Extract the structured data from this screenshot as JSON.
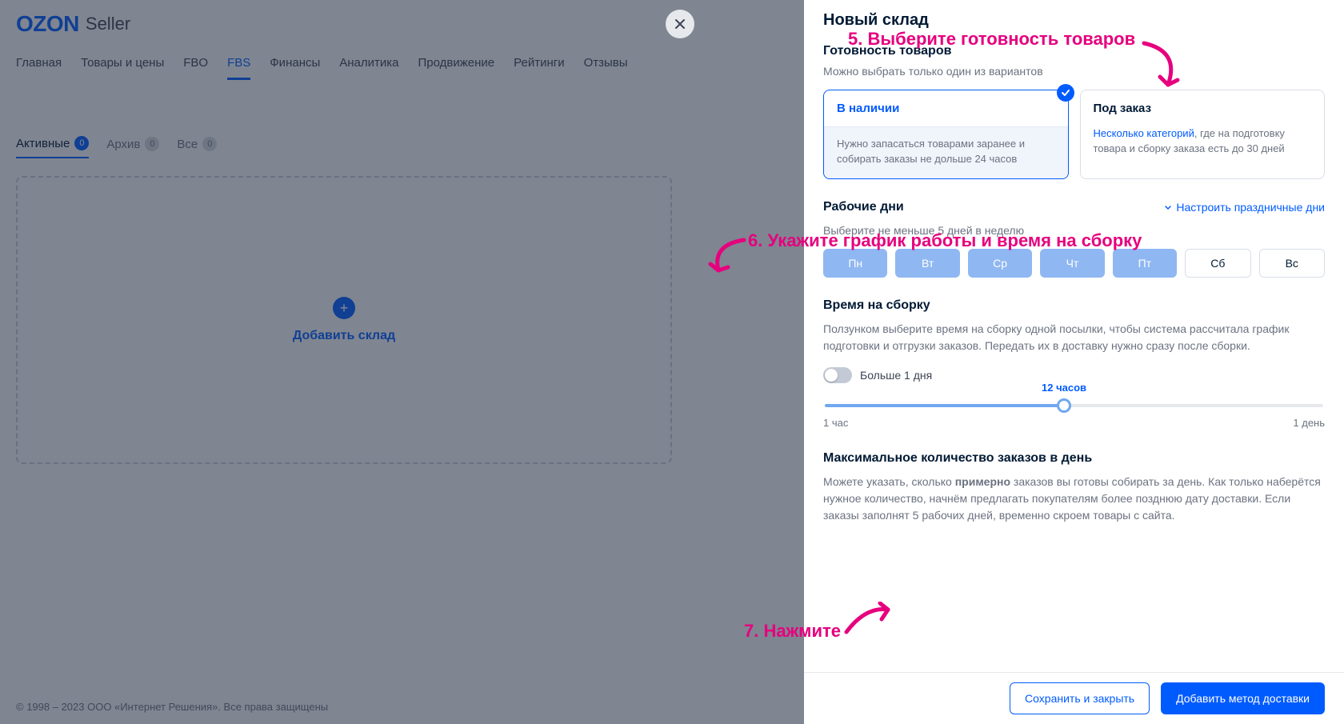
{
  "header": {
    "logo": "OZON",
    "logo_sub": "Seller"
  },
  "nav": {
    "items": [
      "Главная",
      "Товары и цены",
      "FBO",
      "FBS",
      "Финансы",
      "Аналитика",
      "Продвижение",
      "Рейтинги",
      "Отзывы"
    ],
    "active_index": 3
  },
  "subnav": {
    "items": [
      {
        "label": "Активные",
        "count": "0",
        "active": true
      },
      {
        "label": "Архив",
        "count": "0",
        "active": false
      },
      {
        "label": "Все",
        "count": "0",
        "active": false
      }
    ]
  },
  "panel": {
    "add_label": "Добавить склад"
  },
  "footer": "© 1998 – 2023 ООО «Интернет Решения». Все права защищены",
  "sheet": {
    "title": "Новый склад",
    "readiness": {
      "heading": "Готовность товаров",
      "sub": "Можно выбрать только один из вариантов",
      "card_a": {
        "title": "В наличии",
        "body": "Нужно запасаться товарами заранее и собирать заказы не дольше 24 часов"
      },
      "card_b": {
        "title": "Под заказ",
        "link": "Несколько категорий",
        "body_rest": ", где на подготовку товара и сборку заказа есть до 30 дней"
      }
    },
    "days": {
      "heading": "Рабочие дни",
      "config": "Настроить праздничные дни",
      "sub": "Выберите не меньше 5 дней в неделю",
      "labels": [
        "Пн",
        "Вт",
        "Ср",
        "Чт",
        "Пт",
        "Сб",
        "Вс"
      ],
      "selected": [
        true,
        true,
        true,
        true,
        true,
        false,
        false
      ]
    },
    "assembly": {
      "heading": "Время на сборку",
      "sub": "Ползунком выберите время на сборку одной посылки, чтобы система рассчитала график подготовки и отгрузки заказов. Передать их в доставку нужно сразу после сборки.",
      "toggle_label": "Больше 1 дня",
      "toggle_on": false,
      "slider": {
        "min_label": "1 час",
        "max_label": "1 день",
        "value_label": "12 часов",
        "percent": 48
      }
    },
    "max_orders": {
      "heading": "Максимальное количество заказов в день",
      "sub_pre": "Можете указать, сколько ",
      "sub_bold": "примерно",
      "sub_post": " заказов вы готовы собирать за день. Как только наберётся нужное количество, начнём предлагать покупателям более позднюю дату доставки. Если заказы заполнят 5 рабочих дней, временно скроем товары с сайта."
    },
    "buttons": {
      "save": "Сохранить и закрыть",
      "add_method": "Добавить метод доставки"
    }
  },
  "annotations": {
    "a5": "5. Выберите готовность товаров",
    "a6": "6. Укажите график работы и время на сборку",
    "a7": "7. Нажмите"
  }
}
